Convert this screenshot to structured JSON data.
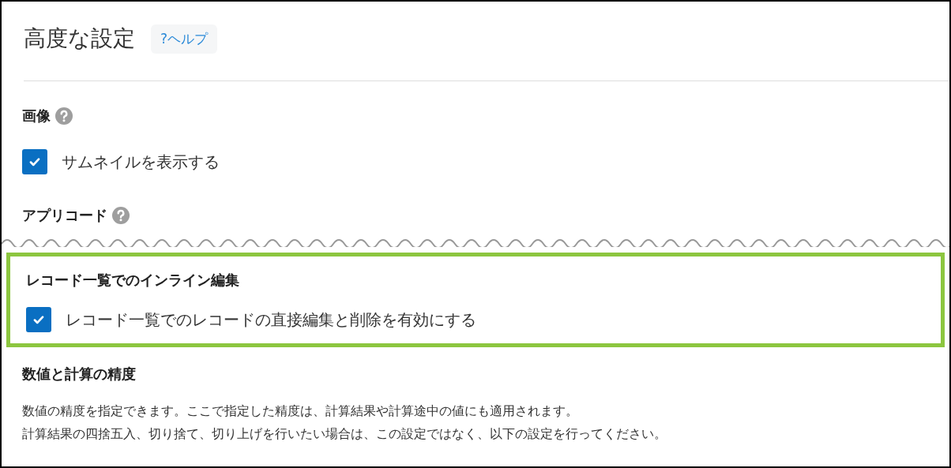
{
  "page": {
    "title": "高度な設定",
    "help_button": "?ヘルプ"
  },
  "sections": [
    {
      "kind": "checkbox",
      "heading": "画像",
      "help_icon": true,
      "highlighted": false,
      "checkbox": {
        "label": "サムネイルを表示する",
        "checked": true
      }
    },
    {
      "kind": "heading",
      "heading": "アプリコード",
      "help_icon": true,
      "highlighted": false
    },
    {
      "kind": "break"
    },
    {
      "kind": "checkbox",
      "heading": "レコード一覧でのインライン編集",
      "help_icon": false,
      "highlighted": true,
      "checkbox": {
        "label": "レコード一覧でのレコードの直接編集と削除を有効にする",
        "checked": true
      }
    },
    {
      "kind": "text",
      "heading": "数値と計算の精度",
      "help_icon": false,
      "highlighted": false,
      "paragraphs": [
        "数値の精度を指定できます。ここで指定した精度は、計算結果や計算途中の値にも適用されます。",
        "計算結果の四捨五入、切り捨て、切り上げを行いたい場合は、この設定ではなく、以下の設定を行ってください。"
      ]
    }
  ]
}
